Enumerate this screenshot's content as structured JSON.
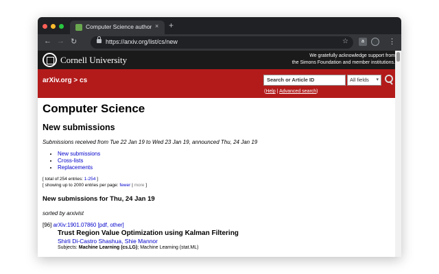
{
  "browser": {
    "tab_title": "Computer Science authors/title",
    "tab_close": "×",
    "new_tab": "+",
    "url": "https://arxiv.org/list/cs/new",
    "back": "←",
    "forward": "→",
    "reload": "↻",
    "star": "☆",
    "ext1": "a",
    "ext2": "",
    "menu": "⋮"
  },
  "header": {
    "institution": "Cornell University",
    "ack_line1": "We gratefully acknowledge support from",
    "ack_line2": "the Simons Foundation and member institutions.",
    "breadcrumb": "arXiv.org > cs",
    "search_placeholder": "Search or Article ID",
    "search_field": "All fields",
    "help_open": "(",
    "help_label": "Help",
    "help_sep": " | ",
    "advanced_label": "Advanced search",
    "help_close": ")"
  },
  "main": {
    "title": "Computer Science",
    "subtitle": "New submissions",
    "received": "Submissions received from Tue 22 Jan 19 to Wed 23 Jan 19, announced Thu, 24 Jan 19",
    "links": [
      "New submissions",
      "Cross-lists",
      "Replacements"
    ],
    "total_prefix": "[ total of 254 entries: ",
    "total_range": "1-254",
    "total_suffix": " ]",
    "showing_prefix": "[ showing up to 2000 entries per page: ",
    "fewer": "fewer",
    "showing_sep": " | ",
    "more": "more",
    "showing_suffix": " ]",
    "section_heading": "New submissions for Thu, 24 Jan 19",
    "sorted": "sorted by arxivist",
    "entry": {
      "index": "[96]",
      "arxiv_id": "arXiv:1901.07860",
      "formats": "[pdf, other]",
      "title": "Trust Region Value Optimization using Kalman Filtering",
      "authors": "Shirli Di-Castro Shashua, Shie Mannor",
      "subjects_label": "Subjects: ",
      "subjects_primary": "Machine Learning (cs.LG)",
      "subjects_rest": "; Machine Learning (stat.ML)"
    }
  },
  "colors": {
    "arxiv_red": "#b31b1b",
    "link_blue": "#0000cc",
    "chrome_dark": "#202124"
  }
}
